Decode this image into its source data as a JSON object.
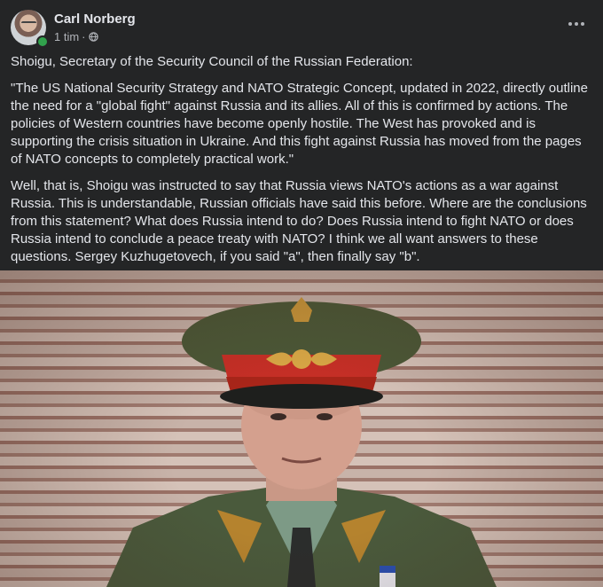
{
  "post": {
    "author": "Carl Norberg",
    "time": "1 tim",
    "separator": "·",
    "paragraphs": [
      "Shoigu, Secretary of the Security Council of the Russian Federation:",
      "\"The US National Security Strategy and NATO Strategic Concept, updated in 2022, directly outline the need for a \"global fight\" against Russia and its allies. All of this is confirmed by actions. The policies of Western countries have become openly hostile. The West has provoked and is supporting the crisis situation in Ukraine. And this fight against Russia has moved from the pages of NATO concepts to completely practical work.\"",
      "Well, that is, Shoigu was instructed to say that Russia views NATO's actions as a war against Russia. This is understandable, Russian officials have said this before. Where are the conclusions from this statement? What does Russia intend to do? Does Russia intend to fight NATO or does Russia intend to conclude a peace treaty with NATO? I think we all want answers to these questions. Sergey Kuzhugetovech, if you said \"a\", then finally say \"b\"."
    ],
    "privacy_icon": "globe-icon",
    "menu_icon": "more-horizontal-icon"
  },
  "colors": {
    "background": "#242526",
    "text_primary": "#e4e6eb",
    "text_secondary": "#b0b3b8",
    "online": "#31a24c"
  }
}
